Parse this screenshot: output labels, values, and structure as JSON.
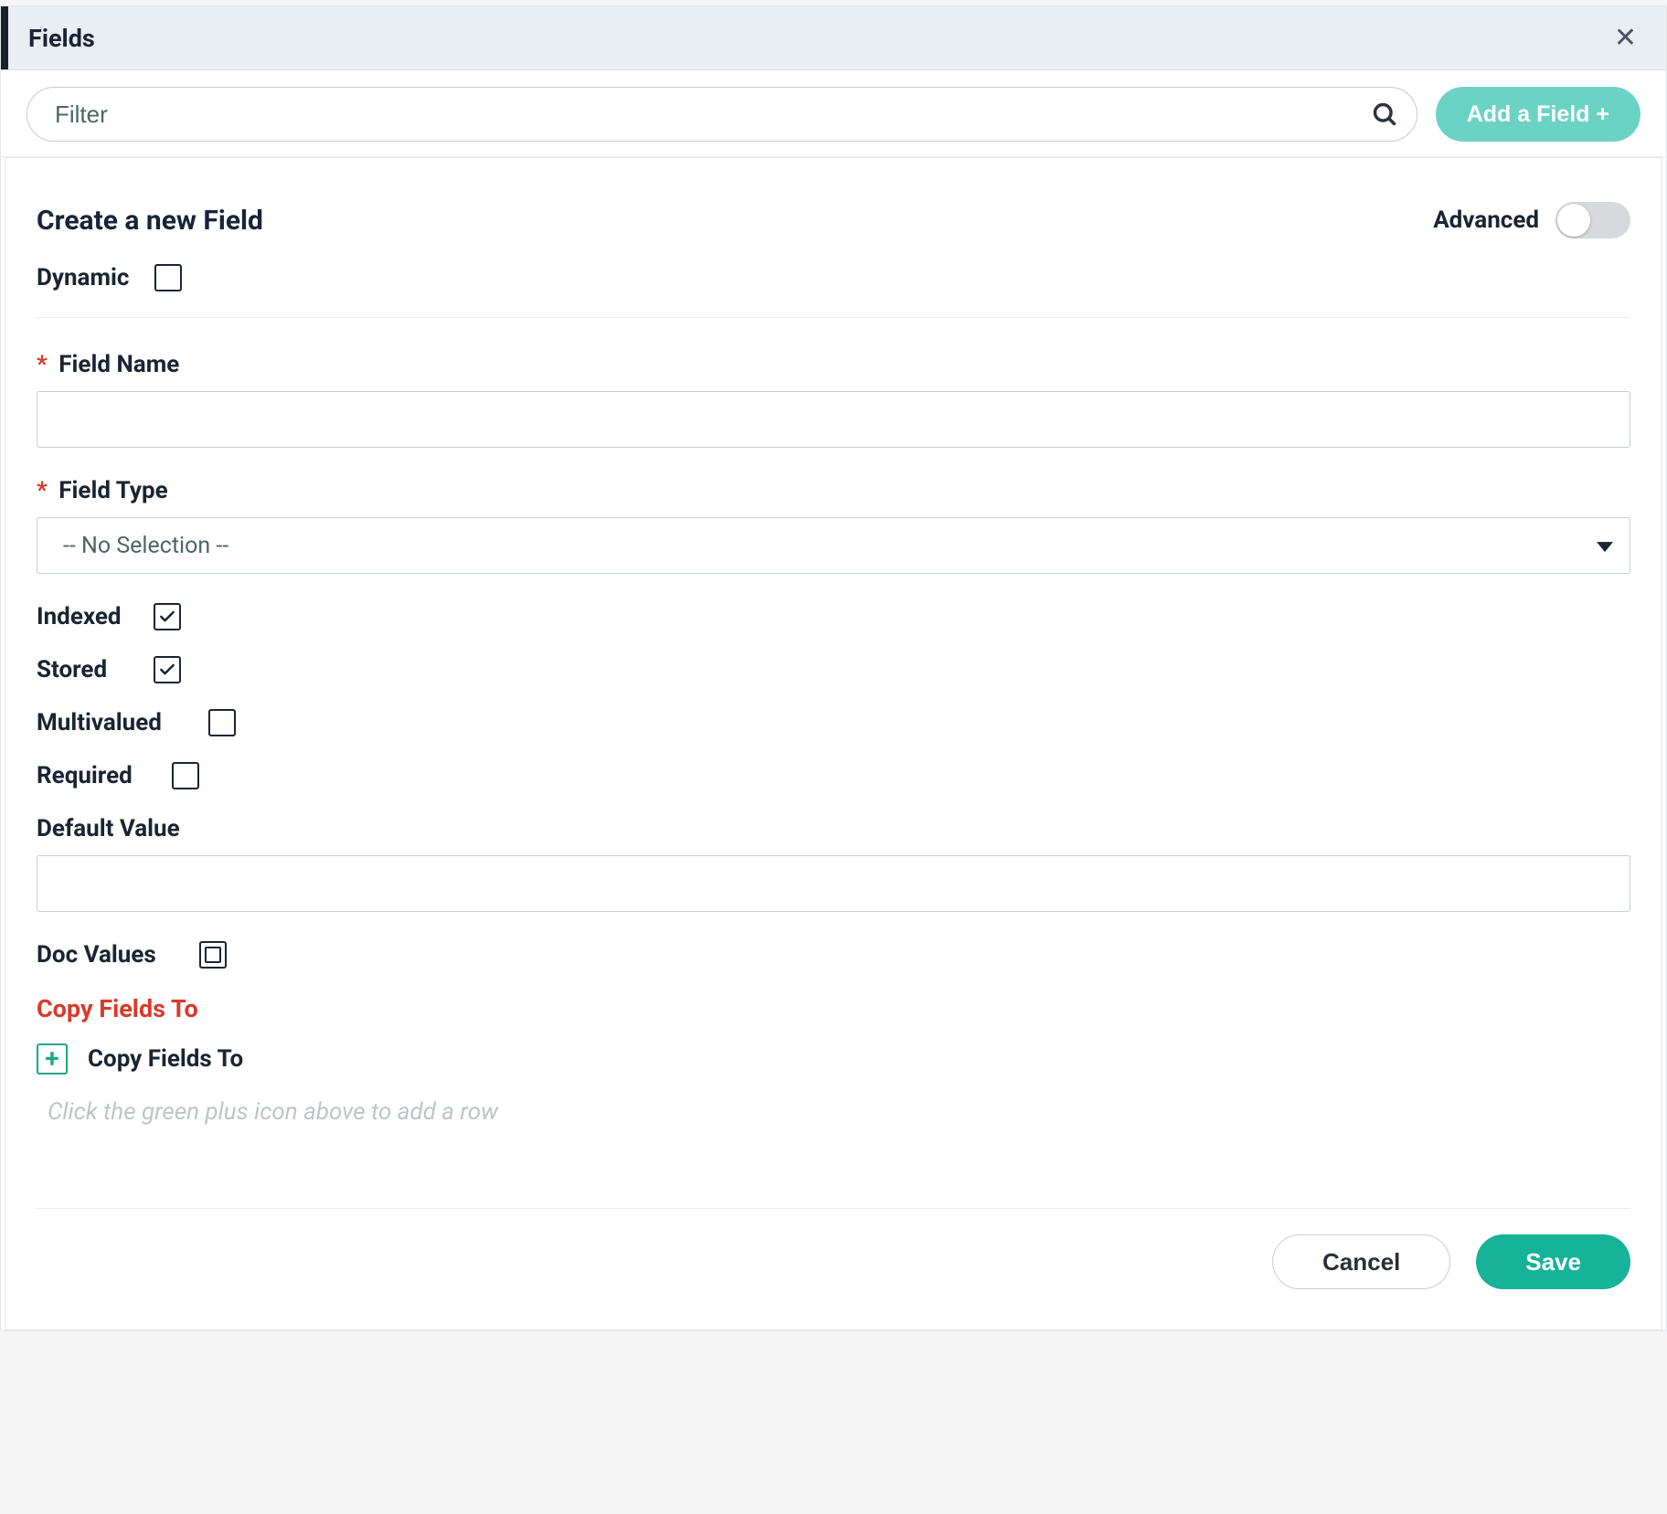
{
  "header": {
    "title": "Fields",
    "close_label": "Close"
  },
  "toolbar": {
    "filter_placeholder": "Filter",
    "add_field_label": "Add a Field +"
  },
  "form": {
    "title": "Create a new Field",
    "advanced_label": "Advanced",
    "dynamic_label": "Dynamic",
    "field_name_label": "Field Name",
    "field_type_label": "Field Type",
    "field_type_placeholder": "-- No Selection --",
    "indexed_label": "Indexed",
    "stored_label": "Stored",
    "multivalued_label": "Multivalued",
    "required_label": "Required",
    "default_value_label": "Default Value",
    "doc_values_label": "Doc Values",
    "copy_fields_heading": "Copy Fields To",
    "copy_fields_sub": "Copy Fields To",
    "copy_fields_hint": "Click the green plus icon above to add a row",
    "cancel_label": "Cancel",
    "save_label": "Save"
  }
}
